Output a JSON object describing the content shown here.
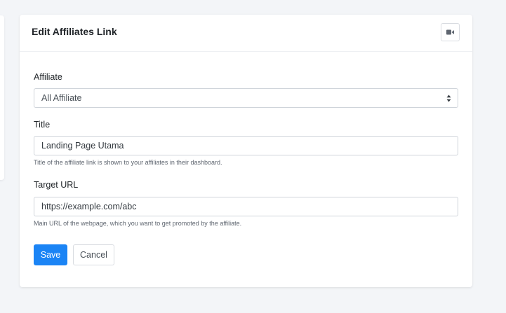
{
  "card": {
    "title": "Edit Affiliates Link",
    "video_icon": "video-camera-icon"
  },
  "form": {
    "affiliate": {
      "label": "Affiliate",
      "selected": "All Affiliate"
    },
    "title": {
      "label": "Title",
      "value": "Landing Page Utama",
      "help": "Title of the affiliate link is shown to your affiliates in their dashboard."
    },
    "target_url": {
      "label": "Target URL",
      "value": "https://example.com/abc",
      "help": "Main URL of the webpage, which you want to get promoted by the affiliate."
    }
  },
  "actions": {
    "save_label": "Save",
    "cancel_label": "Cancel"
  },
  "colors": {
    "primary": "#1b84f5",
    "background": "#f3f5f8"
  }
}
